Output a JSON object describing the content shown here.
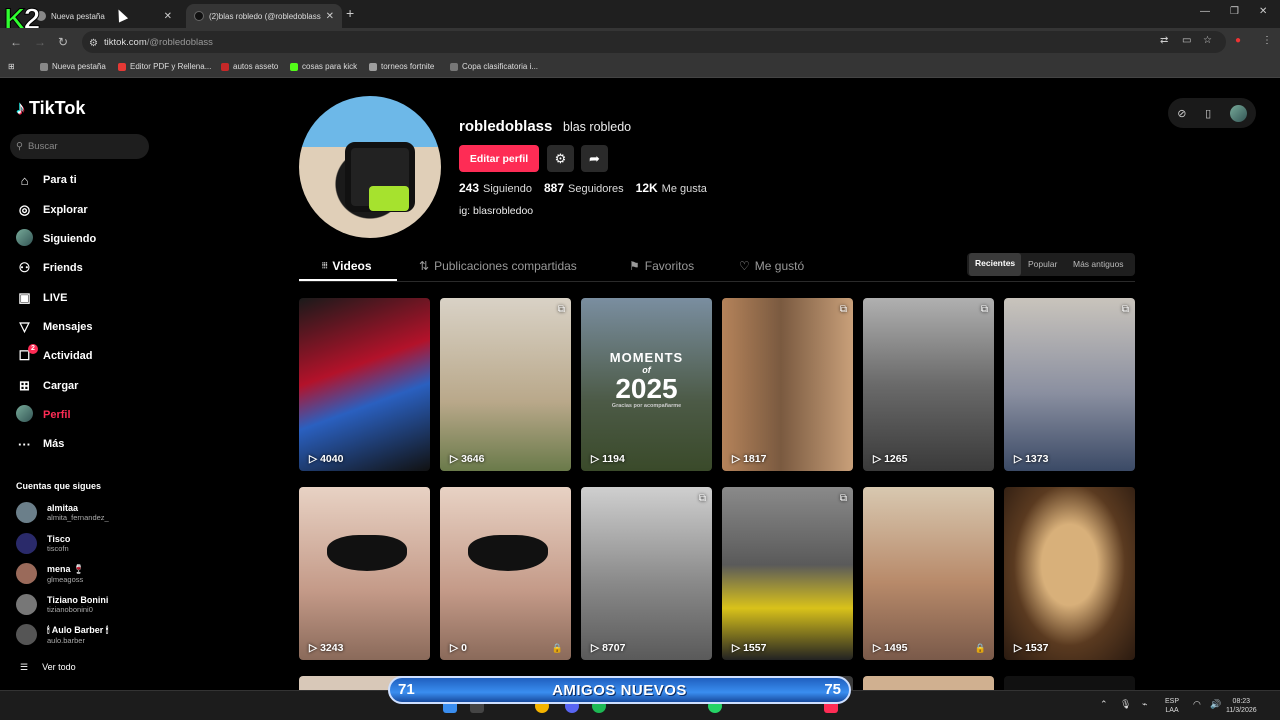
{
  "browser": {
    "tabs": [
      {
        "label": "Nueva pestaña"
      },
      {
        "label": "(2)blas robledo (@robledoblass"
      }
    ],
    "url_host": "tiktok.com",
    "url_path": "/@robledoblass",
    "bookmarks": [
      {
        "label": "Nueva pestaña",
        "color": "#888888"
      },
      {
        "label": "Editor PDF y Rellena...",
        "color": "#e53935"
      },
      {
        "label": "autos asseto",
        "color": "#c62828"
      },
      {
        "label": "cosas para kick",
        "color": "#53fc18"
      },
      {
        "label": "torneos fortnite",
        "color": "#9e9e9e"
      },
      {
        "label": "Copa clasificatoria i...",
        "color": "#777777"
      }
    ]
  },
  "overlay": {
    "logo_k": "K",
    "logo_2": "2"
  },
  "sidebar": {
    "brand": "TikTok",
    "search_placeholder": "Buscar",
    "items": [
      {
        "label": "Para ti",
        "icon": "home-icon",
        "glyph": "⌂"
      },
      {
        "label": "Explorar",
        "icon": "compass-icon",
        "glyph": "◎"
      },
      {
        "label": "Siguiendo",
        "icon": "avatar-icon",
        "glyph": ""
      },
      {
        "label": "Friends",
        "icon": "friends-icon",
        "glyph": "⚇"
      },
      {
        "label": "LIVE",
        "icon": "live-icon",
        "glyph": "▣"
      },
      {
        "label": "Mensajes",
        "icon": "send-icon",
        "glyph": "▽"
      },
      {
        "label": "Actividad",
        "icon": "activity-icon",
        "glyph": "☐",
        "badge": "2"
      },
      {
        "label": "Cargar",
        "icon": "upload-icon",
        "glyph": "⊞"
      },
      {
        "label": "Perfil",
        "icon": "profile-icon",
        "glyph": ""
      },
      {
        "label": "Más",
        "icon": "more-icon",
        "glyph": "···"
      }
    ],
    "following_title": "Cuentas que sigues",
    "following": [
      {
        "name": "almitaa",
        "user": "almita_fernandez_",
        "color": "#6b7f8a"
      },
      {
        "name": "Tisco",
        "user": "tiscofn",
        "color": "#2a2a6a"
      },
      {
        "name": "mena 🍷",
        "user": "glmeagoss",
        "color": "#9a6a5a"
      },
      {
        "name": "Tiziano Bonini",
        "user": "tizianobonini0",
        "color": "#777777"
      },
      {
        "name": "🕯 Aulo Barber 🕯",
        "user": "aulo.barber",
        "color": "#555555"
      }
    ],
    "see_all": "Ver todo"
  },
  "profile": {
    "username": "robledoblass",
    "display_name": "blas robledo",
    "edit_label": "Editar perfil",
    "following_count": "243",
    "following_label": "Siguiendo",
    "followers_count": "887",
    "followers_label": "Seguidores",
    "likes_count": "12K",
    "likes_label": "Me gusta",
    "bio": "ig: blasrobledoo"
  },
  "profile_tabs": [
    {
      "label": "Videos",
      "glyph": "⦙⦙⦙"
    },
    {
      "label": "Publicaciones compartidas",
      "glyph": "⇅"
    },
    {
      "label": "Favoritos",
      "glyph": "⚑"
    },
    {
      "label": "Me gustó",
      "glyph": "♡"
    }
  ],
  "sort": {
    "recent": "Recientes",
    "popular": "Popular",
    "oldest": "Más antiguos"
  },
  "videos": [
    {
      "views": "4040",
      "bg": "linear-gradient(160deg,#1a1a1a,#b3122a 40%,#2a60c0 60%,#111)"
    },
    {
      "views": "3646",
      "bg": "linear-gradient(180deg,#d9d2c6,#b9a88a 60%,#6a7a4a)",
      "multi": true
    },
    {
      "views": "1194",
      "bg": "linear-gradient(180deg,#7a8ea0,#4c5a46 60%,#3a4a2a)",
      "moments": [
        "MOMENTS",
        "of",
        "2025",
        "Gracias por acompañarme"
      ]
    },
    {
      "views": "1817",
      "bg": "linear-gradient(90deg,#b5835a,#7a5a40 45%,#c9a07a)",
      "multi": true
    },
    {
      "views": "1265",
      "bg": "linear-gradient(180deg,#b0b0b0,#6a6a6a 50%,#3a3a3a)",
      "multi": true
    },
    {
      "views": "1373",
      "bg": "linear-gradient(180deg,#c9c4bc,#8a8fa0 55%,#3b4a66)",
      "multi": true
    },
    {
      "views": "3243",
      "bg": "linear-gradient(180deg,#e8d2c4,#c49a88 60%,#8a6a5a)",
      "mask": true
    },
    {
      "views": "0",
      "bg": "linear-gradient(180deg,#e8d2c4,#c49a88 60%,#8a6a5a)",
      "mask": true,
      "lock": true
    },
    {
      "views": "8707",
      "bg": "linear-gradient(180deg,#cfcfcf,#8a8a8a 55%,#5a5a5a)",
      "multi": true
    },
    {
      "views": "1557",
      "bg": "linear-gradient(180deg,#8a8a8a,#5a5a5a 45%,#d9c21a 70%,#222)",
      "multi": true
    },
    {
      "views": "1495",
      "bg": "linear-gradient(180deg,#d8c8b0,#b88a6a 55%,#7a5a4a)",
      "lock": true
    },
    {
      "views": "1537",
      "bg": "radial-gradient(ellipse at 50% 45%,#d8b07a 0 30%,#5a3a20 60%,#2a1a10)"
    }
  ],
  "row3_colors": [
    "#d8c8b8",
    "#a0a0a0",
    "#7a7a7a",
    "#3a3a3a",
    "#d0b090",
    "#111111"
  ],
  "banner": {
    "left": "71",
    "text": "AMIGOS NUEVOS",
    "right": "75"
  },
  "taskbar": {
    "lang1": "ESP",
    "lang2": "LAA",
    "time": "08:23",
    "date": "11/3/2026"
  }
}
